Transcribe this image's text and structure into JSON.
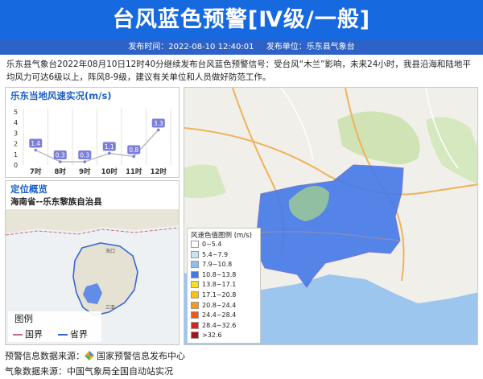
{
  "header": {
    "title": "台风蓝色预警[Ⅳ级/一般]",
    "release_time_label": "发布时间：2022-08-10 12:40:01",
    "issuer_label": "发布单位：乐东县气象台"
  },
  "description": "乐东县气象台2022年08月10日12时40分继续发布台风蓝色预警信号：受台风“木兰”影响，未来24小时，我县沿海和陆地平均风力可达6级以上，阵风8-9级，建议有关单位和人员做好防范工作。",
  "wind_panel": {
    "title": "乐东当地风速实况(m/s)"
  },
  "chart_data": {
    "type": "line",
    "title": "乐东当地风速实况(m/s)",
    "categories": [
      "7时",
      "8时",
      "9时",
      "10时",
      "11时",
      "12时"
    ],
    "values": [
      1.4,
      0.3,
      0.3,
      1.1,
      0.8,
      3.3
    ],
    "yticks": [
      0,
      1,
      2,
      3,
      4,
      5
    ],
    "ylim": [
      0,
      5
    ],
    "grid": "vertical",
    "colors": {
      "line": "#bcbcbc",
      "marker": "#7b7fd8"
    }
  },
  "location_panel": {
    "title": "定位概览",
    "subtitle": "海南省--乐东黎族自治县",
    "inset_labels": [
      "海口",
      "三亚"
    ]
  },
  "map_legend": {
    "title": "风速色值图例 (m/s)",
    "items": [
      {
        "label": "0~5.4",
        "color": "#ffffff"
      },
      {
        "label": "5.4~7.9",
        "color": "#c9e3f5"
      },
      {
        "label": "7.9~10.8",
        "color": "#8cc0ec"
      },
      {
        "label": "10.8~13.8",
        "color": "#3f7ae6"
      },
      {
        "label": "13.8~17.1",
        "color": "#f7e11e"
      },
      {
        "label": "17.1~20.8",
        "color": "#f8c215"
      },
      {
        "label": "20.8~24.4",
        "color": "#f39b1b"
      },
      {
        "label": "24.4~28.4",
        "color": "#eb5a17"
      },
      {
        "label": "28.4~32.6",
        "color": "#d8241c"
      },
      {
        "label": ">32.6",
        "color": "#a51515"
      }
    ]
  },
  "map_legend_box": {
    "title": "图例",
    "items": [
      {
        "label": "国界",
        "color": "#c76b8d"
      },
      {
        "label": "省界",
        "color": "#3867d6"
      }
    ]
  },
  "footer": {
    "source1_label": "预警信息数据来源：",
    "source1_value": "国家预警信息发布中心",
    "source2": "气象数据来源：中国气象局全国自动站实况"
  },
  "colors": {
    "banner": "#1769e0",
    "subbar": "#2d62c6",
    "accent_title": "#1a5fc8",
    "warning_area": "#4479e8"
  }
}
